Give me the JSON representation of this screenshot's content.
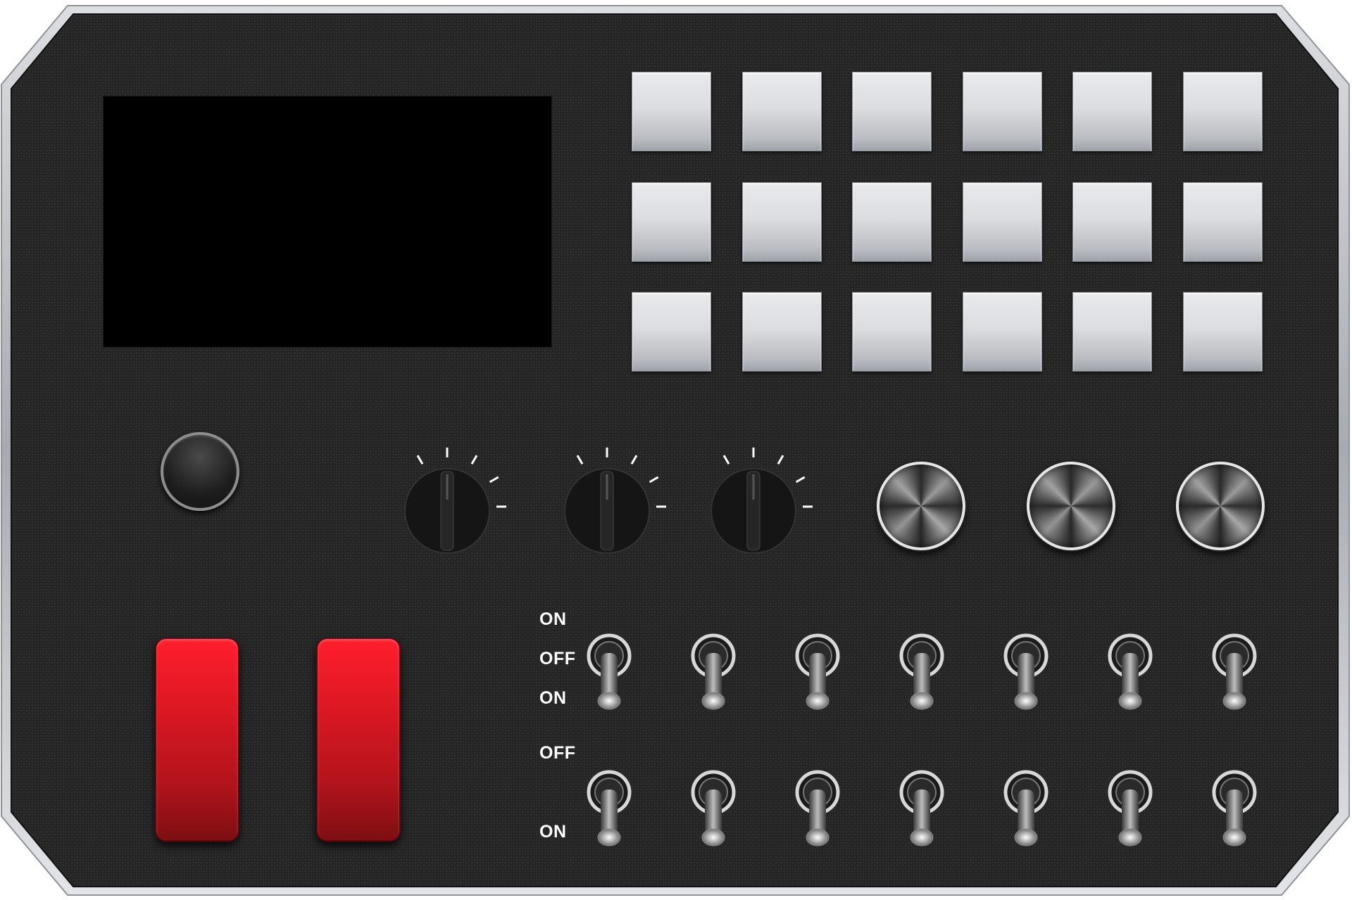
{
  "panel": {
    "body_color": "#262626",
    "frame_color": "#b9bcc0",
    "screen_color": "#000000"
  },
  "pads": {
    "rows": 3,
    "columns": 6,
    "color": "#dcdde0"
  },
  "knobs": {
    "small_knob": "round-knob",
    "rotary_count": 3,
    "rotary_tick_color": "#ffffff"
  },
  "metal_buttons": {
    "count": 3
  },
  "rockers": {
    "count": 2,
    "color": "#e01824"
  },
  "toggle_labels": {
    "row1_top": "ON",
    "row1_mid": "OFF",
    "row1_bottom": "ON",
    "row2_top": "OFF",
    "row2_bottom": "ON"
  },
  "toggles": {
    "rows": 2,
    "per_row": 7
  }
}
